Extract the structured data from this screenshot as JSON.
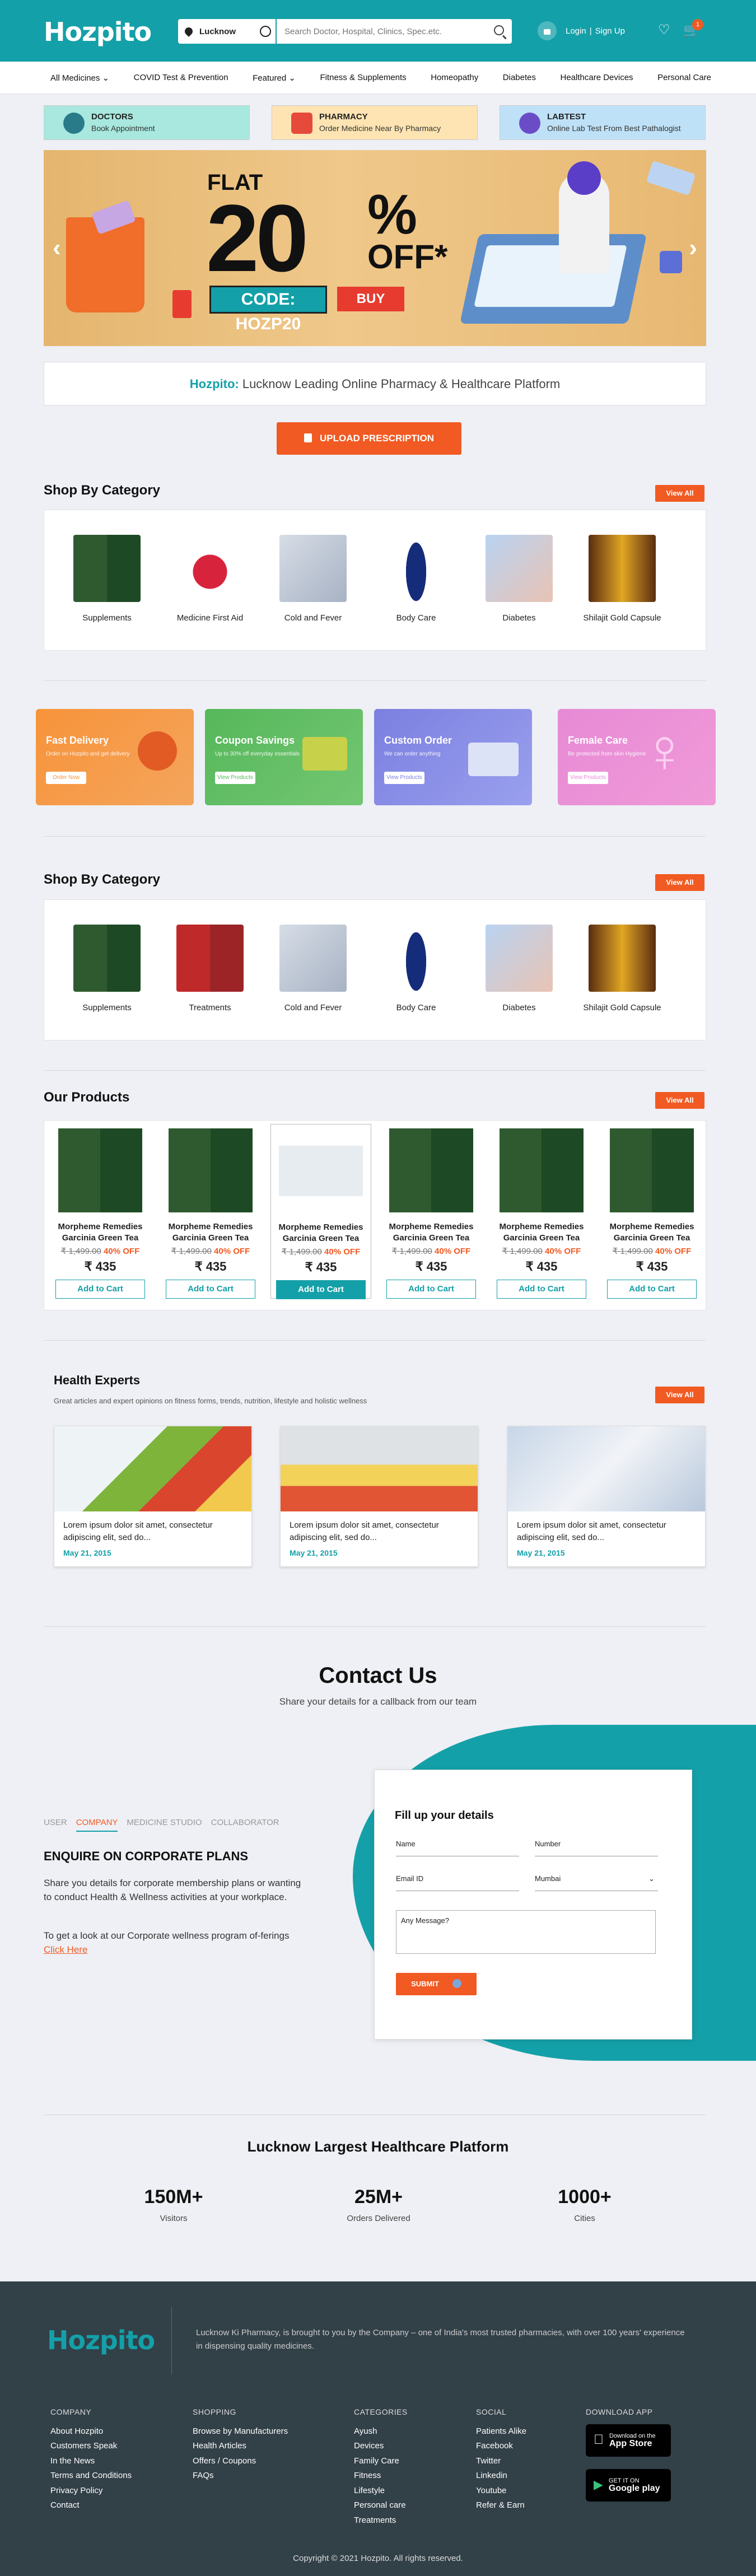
{
  "header": {
    "logo": "Hozpito",
    "location": "Lucknow",
    "search_placeholder": "Search Doctor, Hospital, Clinics, Spec.etc.",
    "login": "Login",
    "signup": "Sign Up",
    "cart_count": "1"
  },
  "nav": [
    "All Medicines",
    "COVID Test & Prevention",
    "Featured",
    "Fitness & Supplements",
    "Homeopathy",
    "Diabetes",
    "Healthcare Devices",
    "Personal Care"
  ],
  "service_tiles": [
    {
      "title": "DOCTORS",
      "sub": "Book Appointment",
      "color": "#a8e8de"
    },
    {
      "title": "PHARMACY",
      "sub": "Order Medicine Near By Pharmacy",
      "color": "#fde4b2"
    },
    {
      "title": "LABTEST",
      "sub": "Online Lab Test From Best Pathalogist",
      "color": "#bfe1f7"
    }
  ],
  "banner": {
    "flat": "FLAT",
    "value": "20",
    "pct": "%",
    "off": "OFF*",
    "code": "CODE: HOZP20",
    "buy": "BUY"
  },
  "tagline": {
    "brand": "Hozpito:",
    "text": " Lucknow Leading Online Pharmacy & Healthcare Platform"
  },
  "upload_button": "UPLOAD PRESCRIPTION",
  "view_all": "View All",
  "category1": {
    "title": "Shop By Category",
    "items": [
      "Supplements",
      "Medicine First Aid",
      "Cold and Fever",
      "Body Care",
      "Diabetes",
      "Shilajit Gold Capsule"
    ]
  },
  "promos": [
    {
      "title": "Fast Delivery",
      "sub": "Order on Hozpito and get delivery",
      "btn": "Order Now",
      "color": "#f7933a"
    },
    {
      "title": "Coupon Savings",
      "sub": "Up to 30% off everyday essentials",
      "btn": "View Products",
      "color": "#56b75a"
    },
    {
      "title": "Custom Order",
      "sub": "We can order anything",
      "btn": "View Products",
      "color": "#7b7fe0"
    },
    {
      "title": "Female Care",
      "sub": "Be protected from skin Hygiene",
      "btn": "View Products",
      "color": "#e78ad6"
    }
  ],
  "category2": {
    "title": "Shop By Category",
    "items": [
      "Supplements",
      "Treatments",
      "Cold and Fever",
      "Body Care",
      "Diabetes",
      "Shilajit Gold Capsule"
    ]
  },
  "products": {
    "title": "Our Products",
    "items": [
      {
        "name": "Morpheme Remedies Garcinia Green Tea",
        "old": "₹ 1,499.00",
        "off": "40% OFF",
        "price": "₹ 435",
        "btn": "Add to Cart"
      },
      {
        "name": "Morpheme Remedies Garcinia Green Tea",
        "old": "₹ 1,499.00",
        "off": "40% OFF",
        "price": "₹ 435",
        "btn": "Add to Cart"
      },
      {
        "name": "Morpheme Remedies Garcinia Green Tea",
        "old": "₹ 1,499.00",
        "off": "40% OFF",
        "price": "₹ 435",
        "btn": "Add to Cart"
      },
      {
        "name": "Morpheme Remedies Garcinia Green Tea",
        "old": "₹ 1,499.00",
        "off": "40% OFF",
        "price": "₹ 435",
        "btn": "Add to Cart"
      },
      {
        "name": "Morpheme Remedies Garcinia Green Tea",
        "old": "₹ 1,499.00",
        "off": "40% OFF",
        "price": "₹ 435",
        "btn": "Add to Cart"
      },
      {
        "name": "Morpheme Remedies Garcinia Green Tea",
        "old": "₹ 1,499.00",
        "off": "40% OFF",
        "price": "₹ 435",
        "btn": "Add to Cart"
      }
    ]
  },
  "experts": {
    "title": "Health Experts",
    "sub": "Great articles and expert opinions on fitness forms, trends, nutrition, lifestyle and holistic wellness",
    "posts": [
      {
        "text": "Lorem ipsum dolor sit amet, consectetur adipiscing elit, sed do...",
        "date": "May 21, 2015"
      },
      {
        "text": "Lorem ipsum dolor sit amet, consectetur adipiscing elit, sed do...",
        "date": "May 21, 2015"
      },
      {
        "text": "Lorem ipsum dolor sit amet, consectetur adipiscing elit, sed do...",
        "date": "May 21, 2015"
      }
    ]
  },
  "contact": {
    "title": "Contact Us",
    "sub": "Share your details for a callback from our team",
    "tabs": [
      "USER",
      "COMPANY",
      "MEDICINE STUDIO",
      "COLLABORATOR"
    ],
    "heading": "ENQUIRE ON CORPORATE PLANS",
    "p1": "Share you details for corporate membership plans or wanting to conduct Health & Wellness activities at your workplace.",
    "p2": "To get a look at our Corporate wellness program of-ferings",
    "link": "Click Here",
    "form_title": "Fill up your details",
    "name": "Name",
    "number": "Number",
    "email": "Email ID",
    "city": "Mumbai",
    "message": "Any Message?",
    "submit": "SUBMIT"
  },
  "stats": {
    "title": "Lucknow Largest Healthcare Platform",
    "items": [
      {
        "value": "150M+",
        "label": "Visitors"
      },
      {
        "value": "25M+",
        "label": "Orders Delivered"
      },
      {
        "value": "1000+",
        "label": "Cities"
      }
    ]
  },
  "footer": {
    "about": "Lucknow Ki Pharmacy, is brought to you by the  Company – one of India's most trusted pharmacies, with over 100 years' experience in dispensing quality medicines.",
    "cols": [
      {
        "title": "COMPANY",
        "links": [
          "About Hozpito",
          "Customers Speak",
          "In the News",
          "Terms and Conditions",
          "Privacy Policy",
          "Contact"
        ]
      },
      {
        "title": "SHOPPING",
        "links": [
          "Browse by Manufacturers",
          "Health Articles",
          "Offers / Coupons",
          "FAQs"
        ]
      },
      {
        "title": "CATEGORIES",
        "links": [
          "Ayush",
          "Devices",
          "Family Care",
          "Fitness",
          "Lifestyle",
          "Personal care",
          "Treatments"
        ]
      },
      {
        "title": "SOCIAL",
        "links": [
          "Patients Alike",
          "Facebook",
          "Twitter",
          "Linkedin",
          "Youtube",
          "Refer & Earn"
        ]
      }
    ],
    "download": "DOWNLOAD APP",
    "appstore_small": "Download on the",
    "appstore": "App Store",
    "play_small": "GET IT ON",
    "play": "Google play",
    "copyright": "Copyright © 2021 Hozpito. All rights reserved."
  }
}
